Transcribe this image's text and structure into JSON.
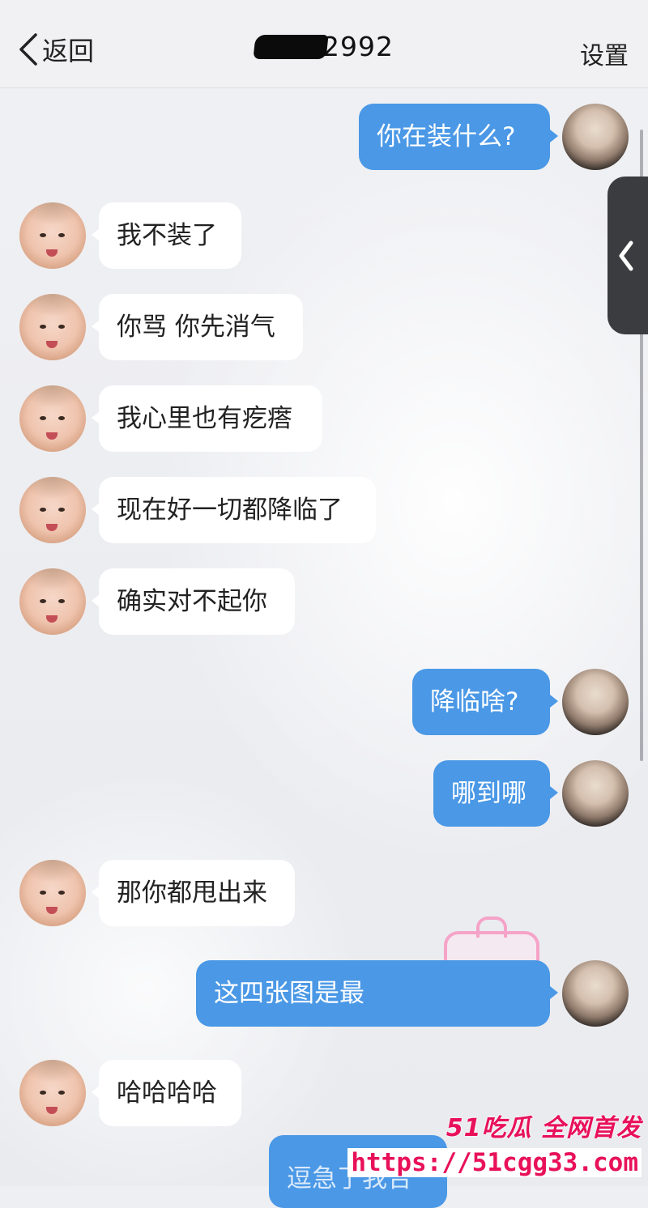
{
  "header": {
    "back_label": "返回",
    "title_visible": "2992",
    "settings_label": "设置"
  },
  "messages": [
    {
      "side": "out",
      "text": "你在装什么?"
    },
    {
      "side": "in",
      "text": "我不装了"
    },
    {
      "side": "in",
      "text": "你骂 你先消气"
    },
    {
      "side": "in",
      "text": "我心里也有疙瘩"
    },
    {
      "side": "in",
      "text": "现在好一切都降临了"
    },
    {
      "side": "in",
      "text": "确实对不起你"
    },
    {
      "side": "out",
      "text": "降临啥?"
    },
    {
      "side": "out",
      "text": "哪到哪"
    },
    {
      "side": "in",
      "text": "那你都甩出来"
    },
    {
      "side": "out",
      "text": "这四张图是最 "
    },
    {
      "side": "in",
      "text": "哈哈哈哈"
    },
    {
      "side": "out",
      "text": "逗急了我合"
    }
  ],
  "watermark": {
    "brand": "51吃瓜 全网首发",
    "url": "https://51cgg33.com"
  },
  "colors": {
    "outgoing_bubble": "#4a98e6",
    "incoming_bubble": "#ffffff",
    "watermark": "#e8115a"
  },
  "icons": {
    "back": "chevron-left-icon",
    "side_tab": "chevron-left-icon"
  }
}
